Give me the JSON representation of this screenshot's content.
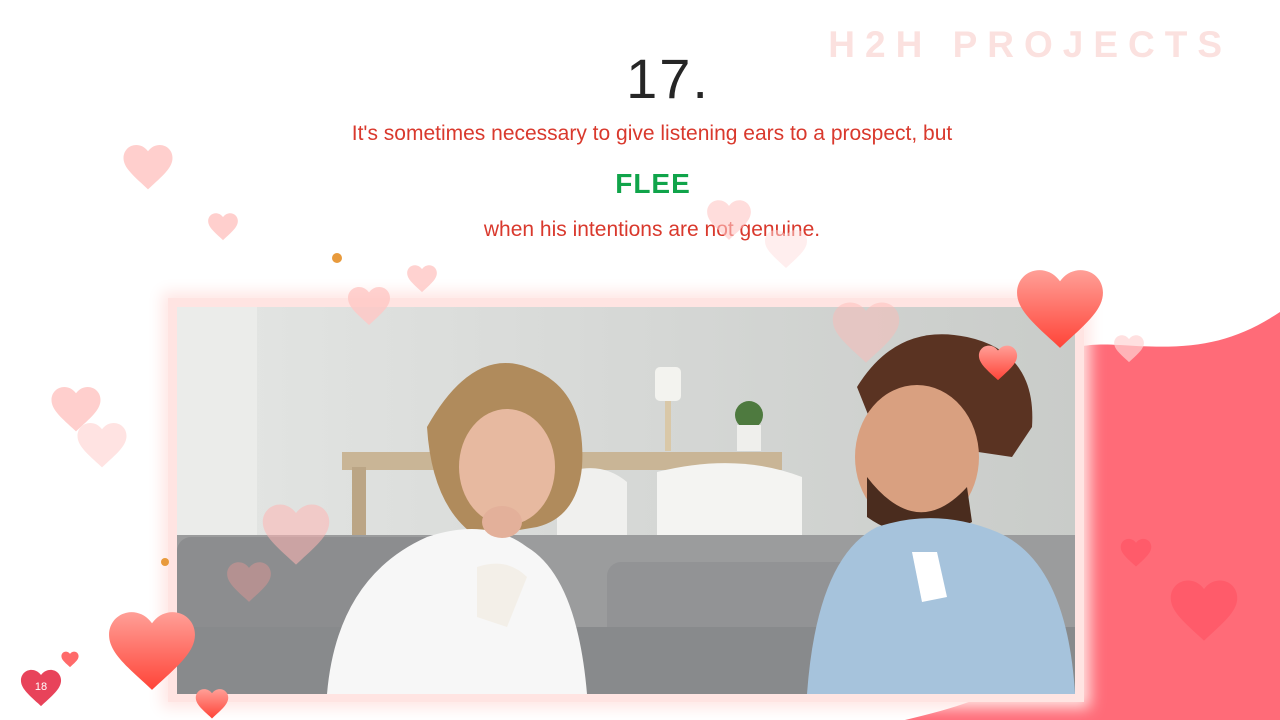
{
  "watermark": "H2H PROJECTS",
  "slide": {
    "number": "17.",
    "line1": "It's sometimes necessary to give listening ears to a prospect, but",
    "emphasis": "FLEE",
    "line2": "when  his intentions are not genuine."
  },
  "page_number": "18",
  "colors": {
    "accent_red": "#d9392d",
    "accent_green": "#10a44a",
    "blob_pink": "#ff6b78",
    "heart_pink": "#ff8a8a"
  },
  "icons": [
    "heart-icon",
    "dot-icon"
  ],
  "photo_alt": "photo-couple-on-sofa"
}
